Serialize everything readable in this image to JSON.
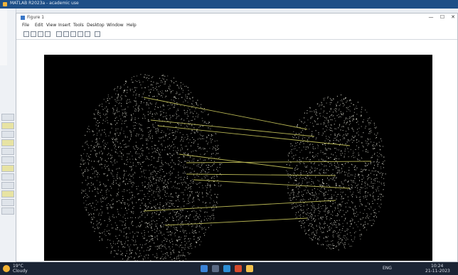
{
  "os_window": {
    "title": "MATLAB R2023a - academic use"
  },
  "figure": {
    "title": "Figure 1",
    "controls": {
      "minimize": "—",
      "maximize": "☐",
      "close": "✕"
    },
    "menu": [
      "File",
      "Edit",
      "View",
      "Insert",
      "Tools",
      "Desktop",
      "Window",
      "Help"
    ]
  },
  "toolbar": {
    "icons": [
      "new-figure-icon",
      "open-icon",
      "save-icon",
      "print-icon",
      "arrow-icon",
      "zoom-in-icon",
      "zoom-out-icon",
      "pan-icon",
      "rotate-icon",
      "data-cursor-icon"
    ]
  },
  "plot": {
    "background": "#000000",
    "point_color": "#f3f3e6",
    "match_line_color": "#b7b553",
    "description_points": "two fingerprint point clouds connected by match lines"
  },
  "taskbar": {
    "weather_temp": "19°C",
    "weather_text": "Cloudy",
    "time": "10:24",
    "date": "21-11-2023",
    "language": "ENG"
  }
}
